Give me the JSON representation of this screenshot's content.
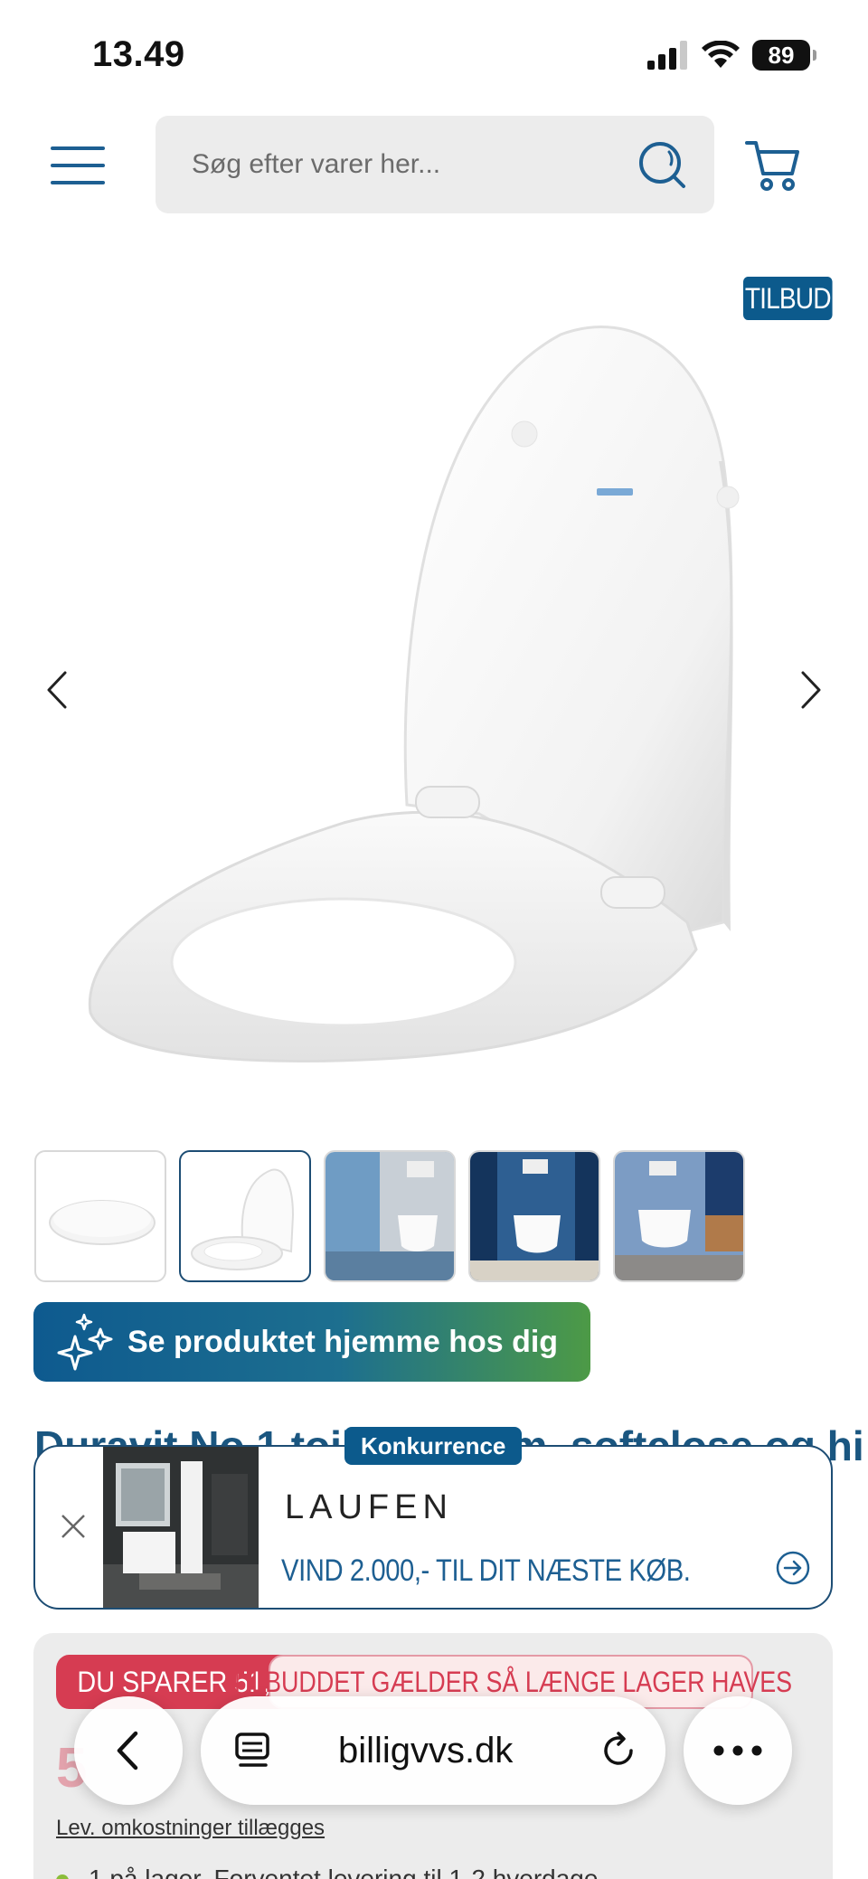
{
  "status_bar": {
    "time": "13.49",
    "battery": "89"
  },
  "header": {
    "search_placeholder": "Søg efter varer her..."
  },
  "product": {
    "badge": "TILBUD",
    "title_visible": "Duravit No.1 toiletsæde m. softclose og hi",
    "try_home_label": "Se produktet hjemme hos dig"
  },
  "promo": {
    "tag": "Konkurrence",
    "brand": "LAUFEN",
    "text": "VIND 2.000,- TIL DIT NÆSTE KØB."
  },
  "price": {
    "save_label": "DU SPARER 51,-",
    "stock_label": "TILBUDDET GÆLDER SÅ LÆNGE LAGER HAVES",
    "current": "5",
    "old": "",
    "delivery_note": "Lev. omkostninger tillægges",
    "bullet_text": "1 på lager. Forventet levering til 1-2 hverdage"
  },
  "browser": {
    "url": "billigvvs.dk"
  },
  "colors": {
    "brand_blue": "#0c5a8c",
    "sale_red": "#d63c52",
    "gradient_green": "#4d9a46"
  }
}
